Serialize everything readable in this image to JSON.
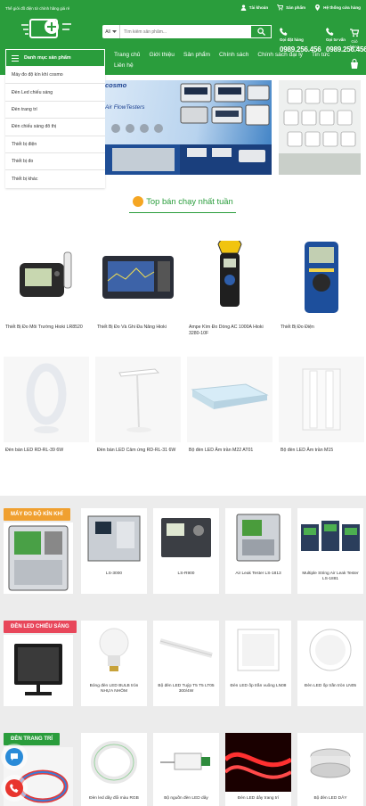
{
  "header": {
    "tagline": "Thế giới đồ điện tử chính hãng giá rẻ",
    "links": [
      "Tài khoản",
      "Sản phẩm",
      "Hệ thống cửa hàng"
    ],
    "search": {
      "category": "All",
      "placeholder": "Tìm kiếm sản phẩm..."
    },
    "contacts": [
      {
        "label": "Gọi đặt hàng",
        "number": "0989.256.456"
      },
      {
        "label": "Gọi tư vấn",
        "number": "0989.256.456"
      }
    ],
    "cart_label": "Giỏ hàng",
    "menu_button": "Danh mục sản phẩm",
    "nav_row1": [
      "Trang chủ",
      "Giới thiệu",
      "Sản phẩm",
      "Chính sách",
      "Chính sách đại lý",
      "Tin tức"
    ],
    "nav_row2": [
      "Liên hệ"
    ]
  },
  "categories": [
    "Máy đo độ kín khí cosmo",
    "Đèn Led chiếu sáng",
    "Đèn trang trí",
    "Đèn chiếu sáng đô thị",
    "Thiết bị điện",
    "Thiết bị đo",
    "Thiết bị khác"
  ],
  "banner": {
    "brand": "cosmo",
    "title": "Air FlowTesters"
  },
  "section_title": "Top bán chạy nhất tuần",
  "products": [
    {
      "name": "Thiết Bị Đo Môi Trường Hioki LR8520"
    },
    {
      "name": "Thiết Bị Đo Và Ghi Đa Năng Hioki"
    },
    {
      "name": "Ampe Kìm Đo Dòng AC 1000A Hioki 3280-10F"
    },
    {
      "name": "Thiết Bị Đo Điện"
    },
    {
      "name": "Đèn bàn LED RD-RL-39 6W"
    },
    {
      "name": "Đèn bàn LED Cảm ứng RD-RL-31 6W"
    },
    {
      "name": "Bộ đèn LED Âm trần M22 AT01"
    },
    {
      "name": "Bộ đèn LED Âm trần M15"
    }
  ],
  "sections": [
    {
      "tag": "MÁY ĐO ĐỘ KÍN KHÍ",
      "color": "#f0a030",
      "items": [
        "LS-3000",
        "LS-R900",
        "Air Leak Tester LS-1813",
        "Multiple String Air Leak Tester LS-1881"
      ]
    },
    {
      "tag": "ĐÈN LED CHIẾU SÁNG",
      "color": "#e8465a",
      "items": [
        "Bóng đèn LED BULB tròn NHỰA NHÔM",
        "Bộ đèn LED Tuýp T5 T5 LT05 300/4W",
        "Đèn LED ốp trần vuông LN08",
        "Đèn LED ốp trần tròn LN05"
      ]
    },
    {
      "tag": "ĐÈN TRANG TRÍ",
      "color": "#2a9d3c",
      "items": [
        "Đèn led dây đổi màu RGB",
        "Bộ nguồn đèn LED dây",
        "Đèn LED dây trang trí",
        "Bộ đèn LED DÂY"
      ]
    }
  ],
  "colors": {
    "brand": "#2a9d3c",
    "accent": "#f5a623"
  }
}
